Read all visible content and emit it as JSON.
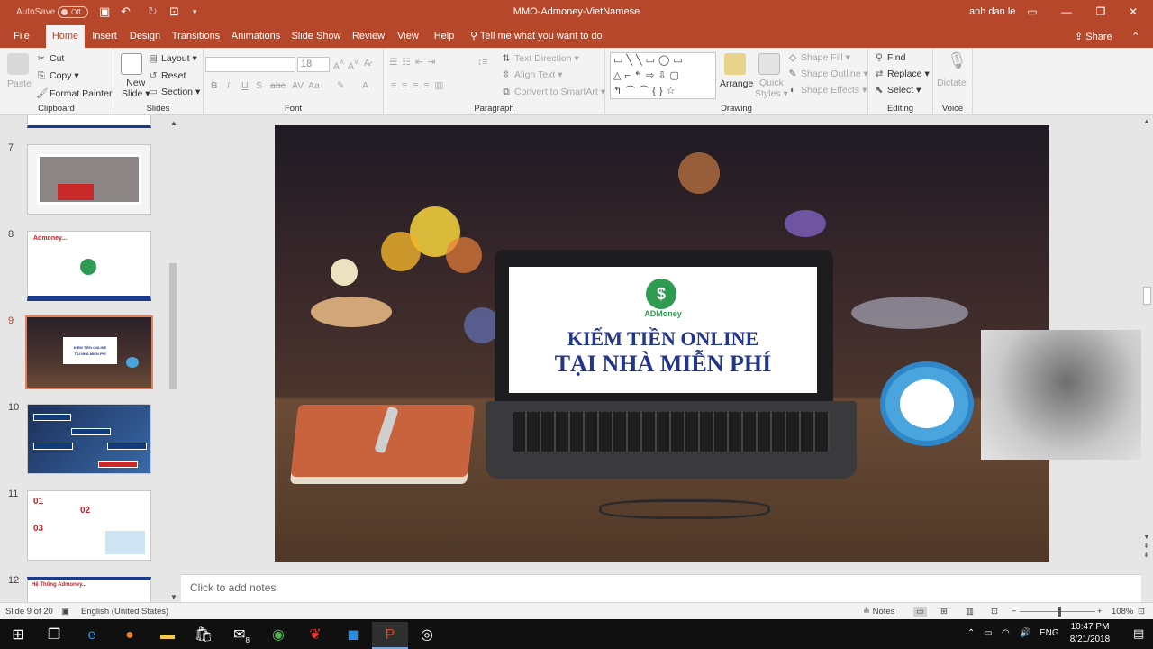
{
  "titlebar": {
    "autosave_label": "AutoSave",
    "autosave_state": "Off",
    "document_title": "MMO-Admoney-VietNamese",
    "user_name": "anh dan le"
  },
  "tabs": [
    "File",
    "Home",
    "Insert",
    "Design",
    "Transitions",
    "Animations",
    "Slide Show",
    "Review",
    "View",
    "Help"
  ],
  "tell_me": "Tell me what you want to do",
  "share_label": "Share",
  "ribbon": {
    "clipboard": {
      "paste": "Paste",
      "cut": "Cut",
      "copy": "Copy",
      "format_painter": "Format Painter",
      "label": "Clipboard"
    },
    "slides": {
      "new_slide_line1": "New",
      "new_slide_line2": "Slide",
      "layout": "Layout",
      "reset": "Reset",
      "section": "Section",
      "label": "Slides"
    },
    "font": {
      "size": "18",
      "label": "Font"
    },
    "paragraph": {
      "text_direction": "Text Direction",
      "align_text": "Align Text",
      "convert_smartart": "Convert to SmartArt",
      "label": "Paragraph"
    },
    "drawing": {
      "arrange": "Arrange",
      "quick_styles_line1": "Quick",
      "quick_styles_line2": "Styles",
      "shape_fill": "Shape Fill",
      "shape_outline": "Shape Outline",
      "shape_effects": "Shape Effects",
      "label": "Drawing"
    },
    "editing": {
      "find": "Find",
      "replace": "Replace",
      "select": "Select",
      "label": "Editing"
    },
    "voice": {
      "dictate": "Dictate",
      "label": "Voice"
    }
  },
  "thumbnails": [
    {
      "number": "7"
    },
    {
      "number": "8",
      "title": "Admoney..."
    },
    {
      "number": "9",
      "selected": true,
      "line1": "KIẾM TIỀN ONLINE",
      "line2": "TẠI NHÀ MIỄN PHÍ"
    },
    {
      "number": "10"
    },
    {
      "number": "11"
    },
    {
      "number": "12",
      "title": "Hệ Thống Admoney..."
    }
  ],
  "slide": {
    "logo_text": "ADMoney",
    "headline_line1": "KIẾM TIỀN ONLINE",
    "headline_line2": "TẠI NHÀ MIỄN PHÍ"
  },
  "notes_placeholder": "Click to add notes",
  "statusbar": {
    "slide_info": "Slide 9 of 20",
    "language": "English (United States)",
    "notes_label": "Notes",
    "zoom": "108%"
  },
  "taskbar": {
    "language": "ENG",
    "time": "10:47 PM",
    "date": "8/21/2018",
    "mail_badge": "8"
  }
}
